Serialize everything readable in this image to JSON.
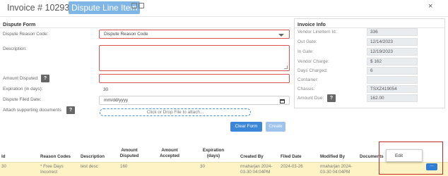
{
  "header": {
    "title": "Invoice # 10293384",
    "tag": "Dispute Line Item",
    "close": "×"
  },
  "dispute_form": {
    "title": "Dispute Form",
    "reason_code_label": "Dispute Reason Code:",
    "reason_code_value": "Dispute Reason Code",
    "description_label": "Description:",
    "amount_label": "Amount Disputed:",
    "expiration_label": "Expiration (in days):",
    "expiration_value": "30",
    "filed_date_label": "Dispute Filed Date:",
    "filed_date_placeholder": "mm/dd/yyyy",
    "attach_label": "Attach supporting documents",
    "drop_text": "Click or Drop File to attach...",
    "clear_button": "Clear Form",
    "create_button": "Create",
    "help": "?"
  },
  "invoice_info": {
    "title": "Invoice Info",
    "rows": [
      {
        "label": "Vendor LineItem Id:",
        "value": "336"
      },
      {
        "label": "Out Gate:",
        "value": "12/14/2023"
      },
      {
        "label": "In Gate:",
        "value": "12/19/2023"
      },
      {
        "label": "Vendor Charge:",
        "value": "$ 162"
      },
      {
        "label": "Days Charged:",
        "value": "6"
      },
      {
        "label": "Container:",
        "value": ""
      },
      {
        "label": "Chassis:",
        "value": "TSXZ419054"
      },
      {
        "label": "Amount Due:",
        "value": "162.00"
      }
    ]
  },
  "table": {
    "headers": {
      "id": "Id",
      "reason_codes": "Reason Codes",
      "description": "Description",
      "amount_disputed": "Amount Disputed",
      "amount_accepted": "Amount Accepted",
      "expiration": "Expiration (days)",
      "created_by": "Created By",
      "filed_date": "Filed Date",
      "modified_by": "Modified By",
      "documents": "Documents"
    },
    "row": {
      "id": "30",
      "reason_codes": "* Free Days Incorrect",
      "description": "test desc",
      "amount_disputed": "160",
      "amount_accepted": "",
      "expiration": "30",
      "created_by": "rmaharjan 2024-03-30 04:04PM",
      "filed_date": "2024-03-26",
      "modified_by": "rmaharjan 2024-03-30 04:04PM",
      "documents": ""
    },
    "menu_item": "Edit",
    "dots": "..."
  },
  "colors": {
    "accent": "#3b86d6",
    "error": "#d9534f",
    "row_highlight": "#fdf3c4",
    "annotation": "#c62828"
  }
}
